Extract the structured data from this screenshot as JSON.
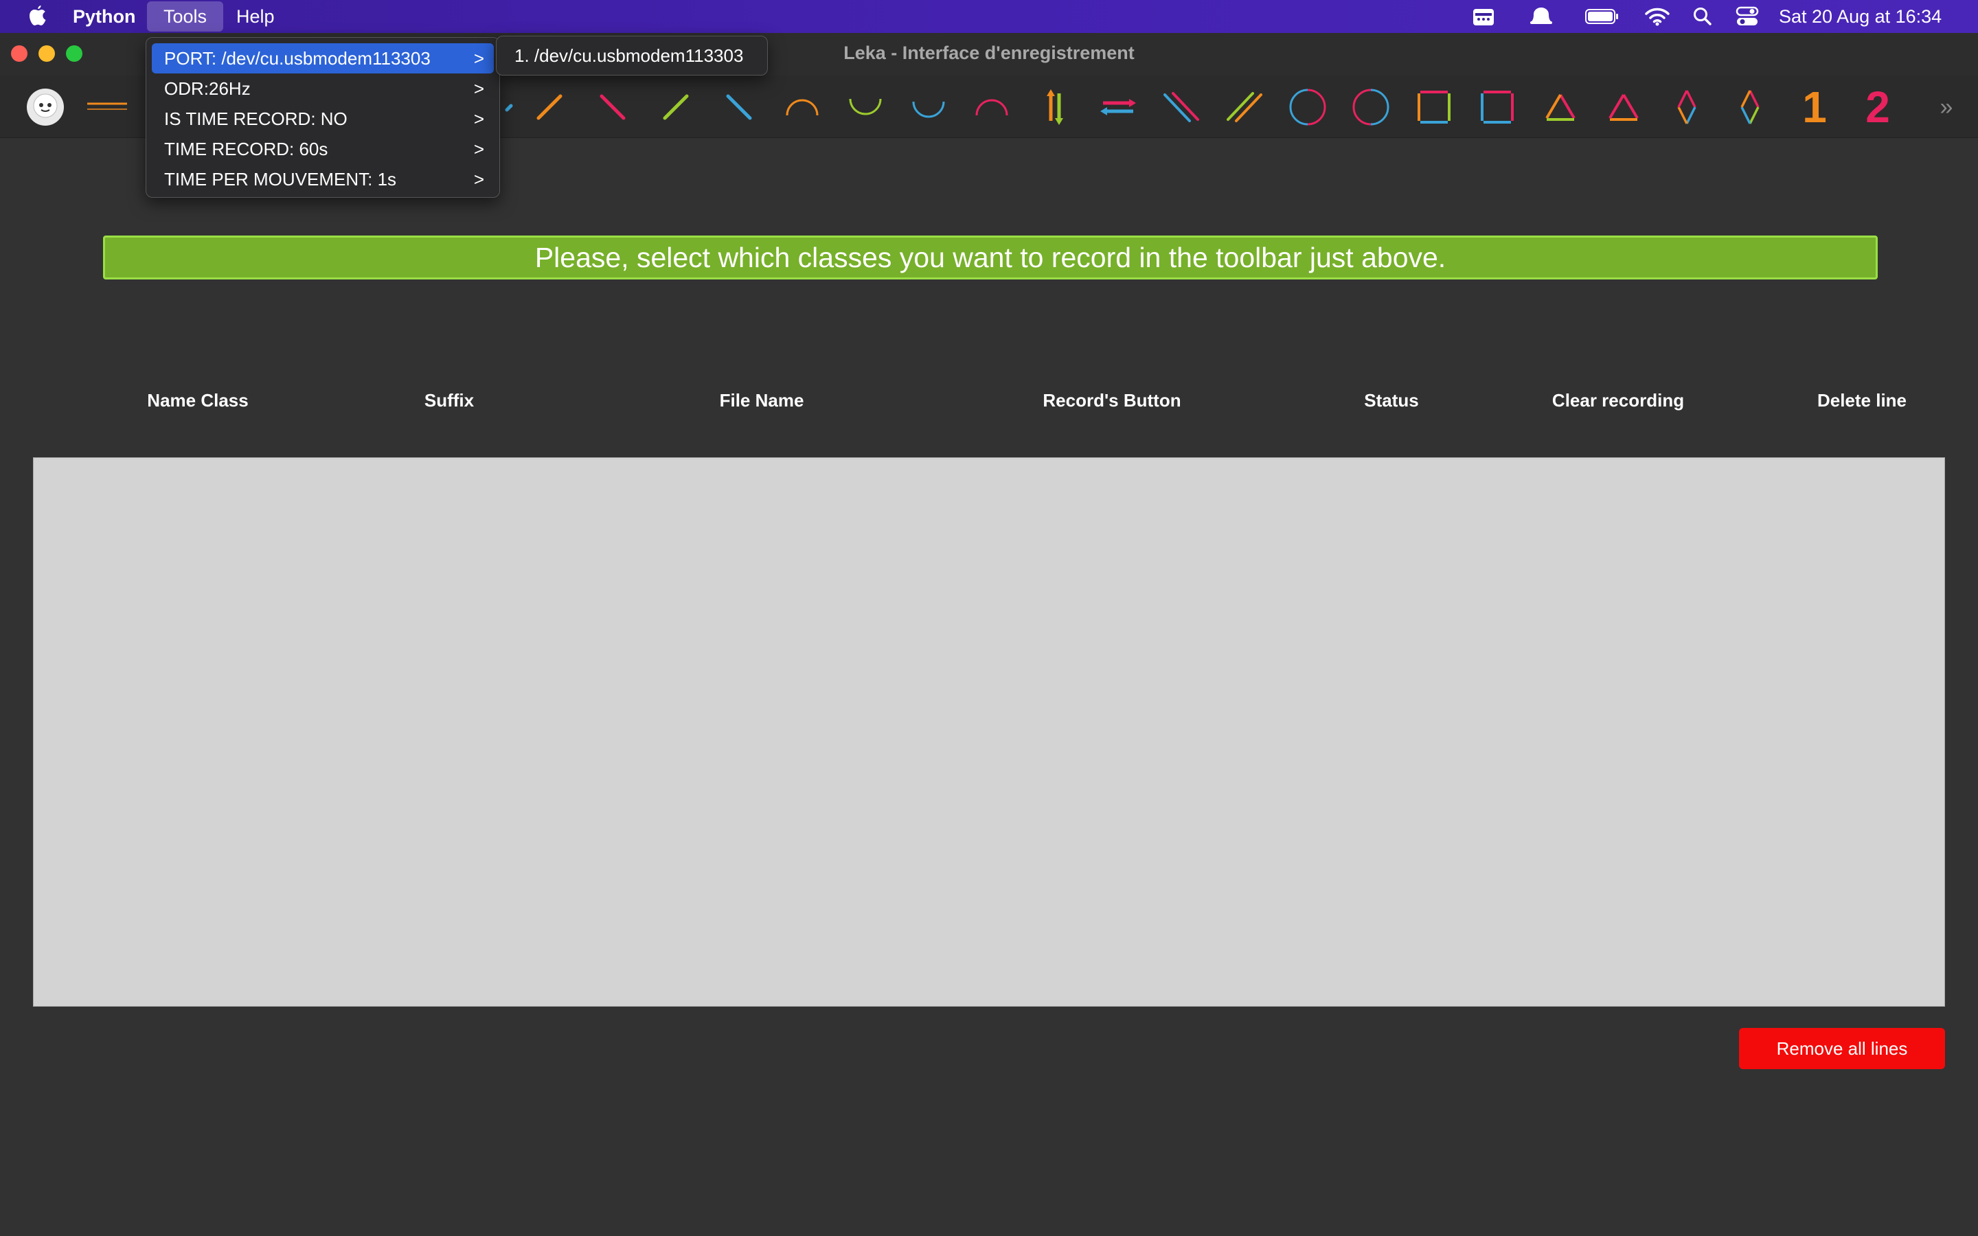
{
  "menubar": {
    "app_name": "Python",
    "items": [
      "Tools",
      "Help"
    ],
    "clock": "Sat 20 Aug at  16:34",
    "status_icons": [
      "calendar-icon",
      "notification-bell-icon",
      "battery-icon",
      "wifi-icon",
      "search-icon",
      "control-center-icon"
    ]
  },
  "window": {
    "title": "Leka - Interface d'enregistrement"
  },
  "tools_menu": {
    "items": [
      {
        "label": "PORT: /dev/cu.usbmodem113303",
        "selected": true
      },
      {
        "label": "ODR:26Hz"
      },
      {
        "label": "IS TIME RECORD: NO"
      },
      {
        "label": "TIME RECORD: 60s"
      },
      {
        "label": "TIME PER MOUVEMENT: 1s"
      }
    ],
    "submenu": [
      "1. /dev/cu.usbmodem113303"
    ]
  },
  "toolbar": {
    "icons": [
      "robot-logo-icon",
      "logo-strip-icon",
      "diagonal-up-orange-icon",
      "diagonal-down-pink-icon",
      "diagonal-up-green-icon",
      "diagonal-down-blue-icon",
      "arc-up-orange-icon",
      "arc-down-green-icon",
      "arc-down-blue-icon",
      "arc-up-pink-icon",
      "vertical-arrows-icon",
      "horizontal-arrows-icon",
      "double-diagonal-down-icon",
      "double-diagonal-up-icon",
      "circle-pink-blue-icon",
      "circle-blue-pink-icon",
      "square-clockwise-icon",
      "square-counterclockwise-icon",
      "triangle-clockwise-icon",
      "triangle-counterclockwise-icon",
      "diamond-clockwise-icon",
      "diamond-counterclockwise-icon",
      "number-one-icon",
      "number-two-icon"
    ],
    "numbers": [
      "1",
      "2"
    ],
    "overflow": "»"
  },
  "banner": {
    "text": "Please, select which classes you want to record in the toolbar just above."
  },
  "table": {
    "columns": [
      "Name Class",
      "Suffix",
      "File Name",
      "Record's Button",
      "Status",
      "Clear recording",
      "Delete line"
    ],
    "rows": []
  },
  "actions": {
    "remove_all": "Remove all lines"
  },
  "colors": {
    "banner": "#77b02a",
    "remove_button": "#f30b0b",
    "menu_selection": "#2c63d8",
    "orange": "#f08a1c",
    "pink": "#e8225f",
    "green": "#9ccb2d",
    "blue": "#3aa3d8"
  }
}
